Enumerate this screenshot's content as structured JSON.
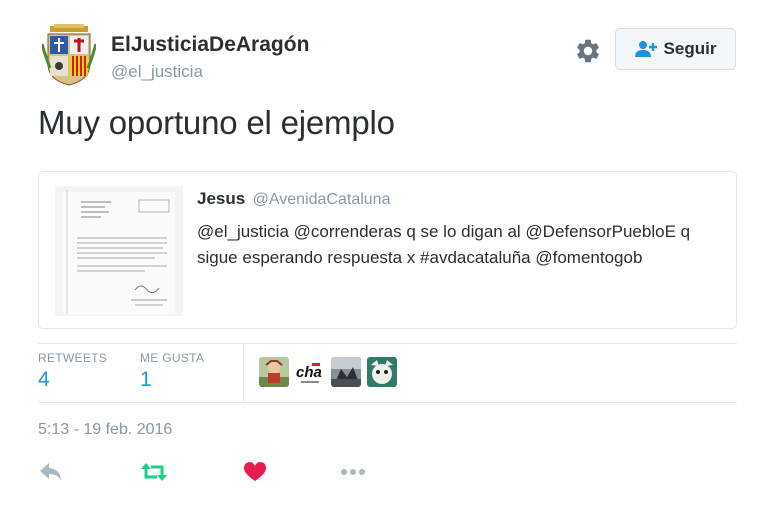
{
  "author": {
    "name": "ElJusticiaDeAragón",
    "handle": "@el_justicia",
    "follow_label": "Seguir",
    "avatar_icon": "aragon-coat-of-arms-avatar"
  },
  "tweet": {
    "text": "Muy oportuno el ejemplo",
    "timestamp": "5:13 - 19 feb. 2016"
  },
  "quote": {
    "author_name": "Jesus",
    "author_handle": "@AvenidaCataluna",
    "text": "@el_justicia @correnderas q se lo digan al @DefensorPuebloE q sigue esperando respuesta x #avdacataluña @fomentogob",
    "thumbnail_icon": "scanned-letter-document-image"
  },
  "stats": {
    "retweets_label": "RETWEETS",
    "retweets_count": "4",
    "likes_label": "ME GUSTA",
    "likes_count": "1",
    "liker_avatars": [
      "liker-avatar-cartoon",
      "liker-avatar-cha-logo",
      "liker-avatar-photo",
      "liker-avatar-character"
    ]
  },
  "actions": {
    "icons": [
      "reply-icon",
      "retweet-icon",
      "heart-icon",
      "more-icon"
    ]
  },
  "colors": {
    "link_blue": "#1b95e0",
    "retweet_green": "#19cf86",
    "like_red": "#e81c4f",
    "muted_gray": "#8899a6",
    "text_dark": "#292f33",
    "border": "#e1e8ed"
  }
}
